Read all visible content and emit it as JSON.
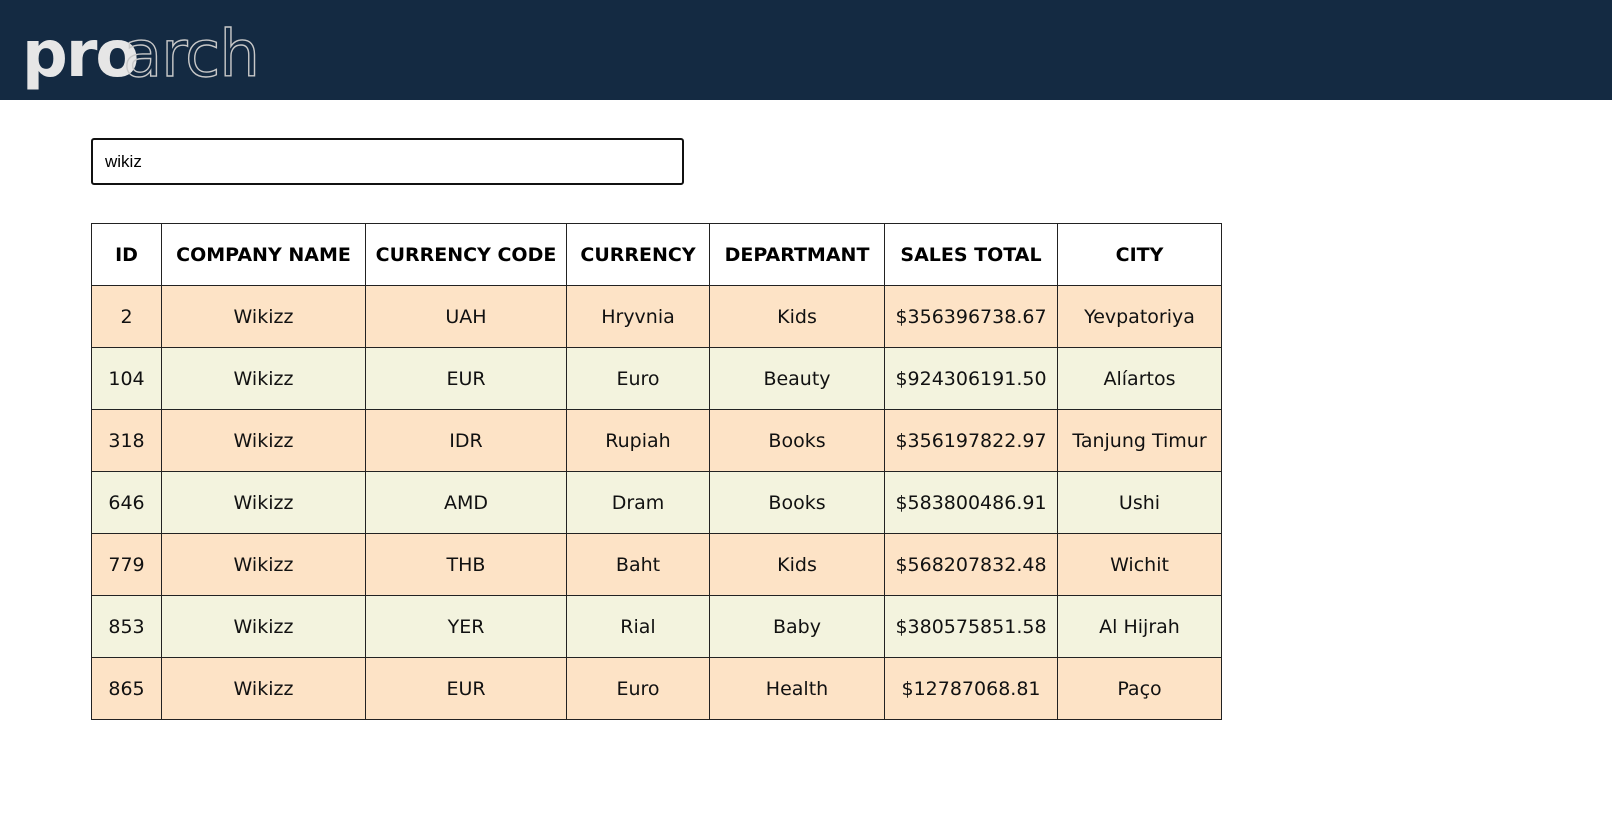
{
  "brand": {
    "logo_text_bold": "pro",
    "logo_text_outline": "arch",
    "header_color": "#142a42"
  },
  "search": {
    "value": "wikiz",
    "placeholder": ""
  },
  "table": {
    "columns": [
      "ID",
      "COMPANY NAME",
      "CURRENCY CODE",
      "CURRENCY",
      "DEPARTMANT",
      "SALES TOTAL",
      "CITY"
    ],
    "rows": [
      [
        "2",
        "Wikizz",
        "UAH",
        "Hryvnia",
        "Kids",
        "$356396738.67",
        "Yevpatoriya"
      ],
      [
        "104",
        "Wikizz",
        "EUR",
        "Euro",
        "Beauty",
        "$924306191.50",
        "Alíartos"
      ],
      [
        "318",
        "Wikizz",
        "IDR",
        "Rupiah",
        "Books",
        "$356197822.97",
        "Tanjung Timur"
      ],
      [
        "646",
        "Wikizz",
        "AMD",
        "Dram",
        "Books",
        "$583800486.91",
        "Ushi"
      ],
      [
        "779",
        "Wikizz",
        "THB",
        "Baht",
        "Kids",
        "$568207832.48",
        "Wichit"
      ],
      [
        "853",
        "Wikizz",
        "YER",
        "Rial",
        "Baby",
        "$380575851.58",
        "Al Hijrah"
      ],
      [
        "865",
        "Wikizz",
        "EUR",
        "Euro",
        "Health",
        "$12787068.81",
        "Paço"
      ]
    ],
    "row_colors": {
      "odd": "#fde3c6",
      "even": "#f3f3de"
    }
  }
}
